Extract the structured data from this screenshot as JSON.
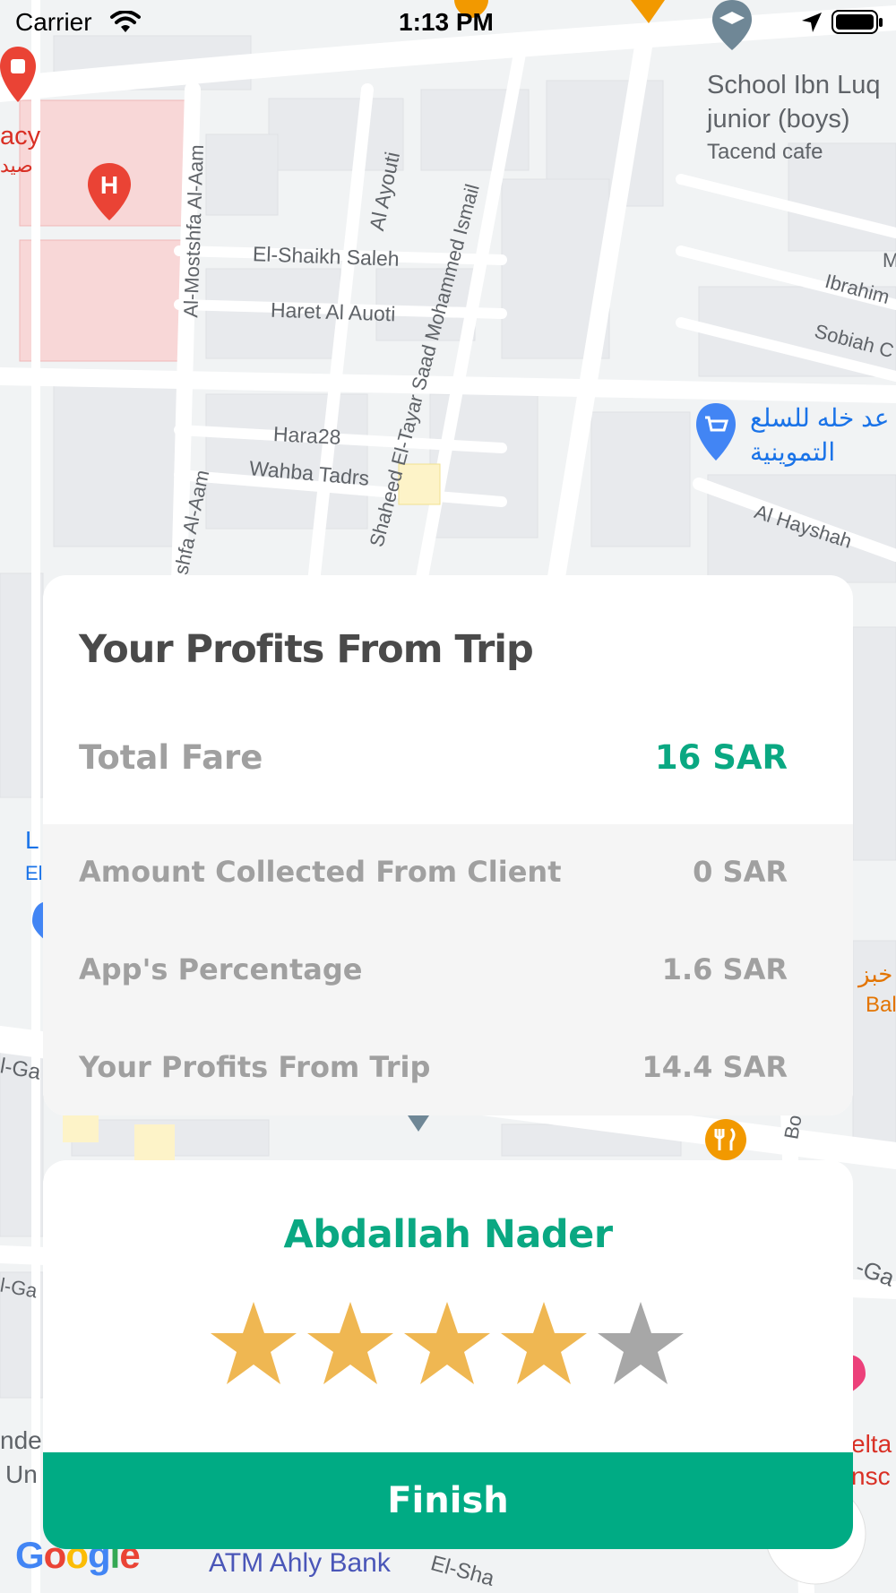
{
  "status_bar": {
    "carrier": "Carrier",
    "time": "1:13 PM"
  },
  "map": {
    "labels": {
      "school_line1": "School Ibn Luq",
      "school_line2": "junior (boys)",
      "tacend_cafe": "Tacend cafe",
      "pharmacy_en": "acy",
      "pharmacy_ar": "صيد",
      "street_el_shaikh_saleh": "El-Shaikh Saleh",
      "street_haret_al_auoti": "Haret Al Auoti",
      "street_hara28": "Hara28",
      "street_wahba_tadrs": "Wahba Tadrs",
      "street_al_ayouti": "Al Ayouti",
      "street_al_mostshfa_al_aam": "Al-Mostshfa Al-Aam",
      "street_shfa_al_aam": "shfa Al-Aam",
      "street_saad_mohammed_ismail": "Shaheed El-Tayar Saad Mohammed Ismail",
      "street_ibrahim": "Ibrahim",
      "street_m": "M",
      "street_sobiah": "Sobiah C",
      "street_al_hayshah": "Al Hayshah",
      "grocery_ar_line1": "عد خله للسلع",
      "grocery_ar_line2": "التموينية",
      "left_l": "L",
      "left_el": "El",
      "bakery_ar": "خبز",
      "bakery_en": "Bal",
      "ga_left_1": "l-Ga",
      "ga_left_2": "l-Ga",
      "ga_right": "-Ga",
      "bo": "Bo",
      "nde": "nde",
      "un": "Un",
      "elta": "elta I",
      "nsc": "nsc",
      "atm": "ATM Ahly Bank",
      "el_sha": "El-Sha",
      "google": "Google"
    }
  },
  "profits_card": {
    "title": "Your Profits From Trip",
    "total_fare": {
      "label": "Total Fare",
      "value": "16 SAR"
    },
    "amount_collected": {
      "label": "Amount Collected From Client",
      "value": "0 SAR"
    },
    "app_percentage": {
      "label": "App's Percentage",
      "value": "1.6 SAR"
    },
    "your_profits": {
      "label": "Your Profits From Trip",
      "value": "14.4 SAR"
    }
  },
  "rating_card": {
    "driver_name": "Abdallah Nader",
    "rating": 4,
    "max_rating": 5,
    "finish_label": "Finish"
  },
  "colors": {
    "accent": "#00ab84",
    "accent_text": "#0aa882",
    "star_filled": "#efb752",
    "star_empty": "#a7a7a7",
    "muted_text": "#a0a0a0",
    "title_text": "#4a4a4a"
  }
}
